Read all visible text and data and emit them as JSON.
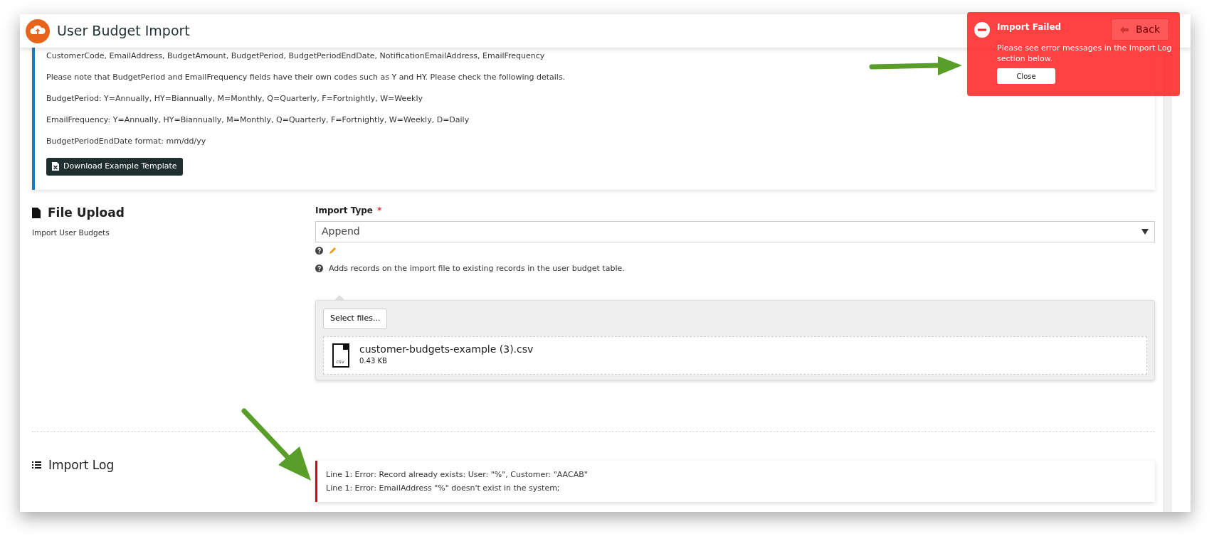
{
  "header": {
    "title": "User Budget Import",
    "back_button": "Back"
  },
  "instructions": {
    "lines": [
      "CustomerCode, EmailAddress, BudgetAmount, BudgetPeriod, BudgetPeriodEndDate, NotificationEmailAddress, EmailFrequency",
      "Please note that BudgetPeriod and EmailFrequency fields have their own codes such as Y and HY. Please check the following details.",
      "BudgetPeriod: Y=Annually, HY=Biannually, M=Monthly, Q=Quarterly, F=Fortnightly, W=Weekly",
      "EmailFrequency: Y=Annually, HY=Biannually, M=Monthly, Q=Quarterly, F=Fortnightly, W=Weekly, D=Daily",
      "BudgetPeriodEndDate format: mm/dd/yy"
    ],
    "download_button": "Download Example Template"
  },
  "file_upload": {
    "title": "File Upload",
    "subtitle": "Import User Budgets",
    "import_type": {
      "label": "Import Type",
      "required": true,
      "required_mark": "*",
      "value": "Append"
    },
    "help_text": "Adds records on the import file to existing records in the user budget table.",
    "select_button": "Select files...",
    "files": [
      {
        "name": "customer-budgets-example (3).csv",
        "size": "0.43 KB",
        "extension": "csv"
      }
    ]
  },
  "import_log": {
    "title": "Import Log",
    "entries": [
      "Line 1: Error: Record already exists: User: \"%\", Customer: \"AACAB\"",
      "Line 1: Error: EmailAddress \"%\" doesn't exist in the system;"
    ]
  },
  "toast": {
    "title": "Import Failed",
    "message": "Please see error messages in the Import Log section below.",
    "close_button": "Close"
  }
}
